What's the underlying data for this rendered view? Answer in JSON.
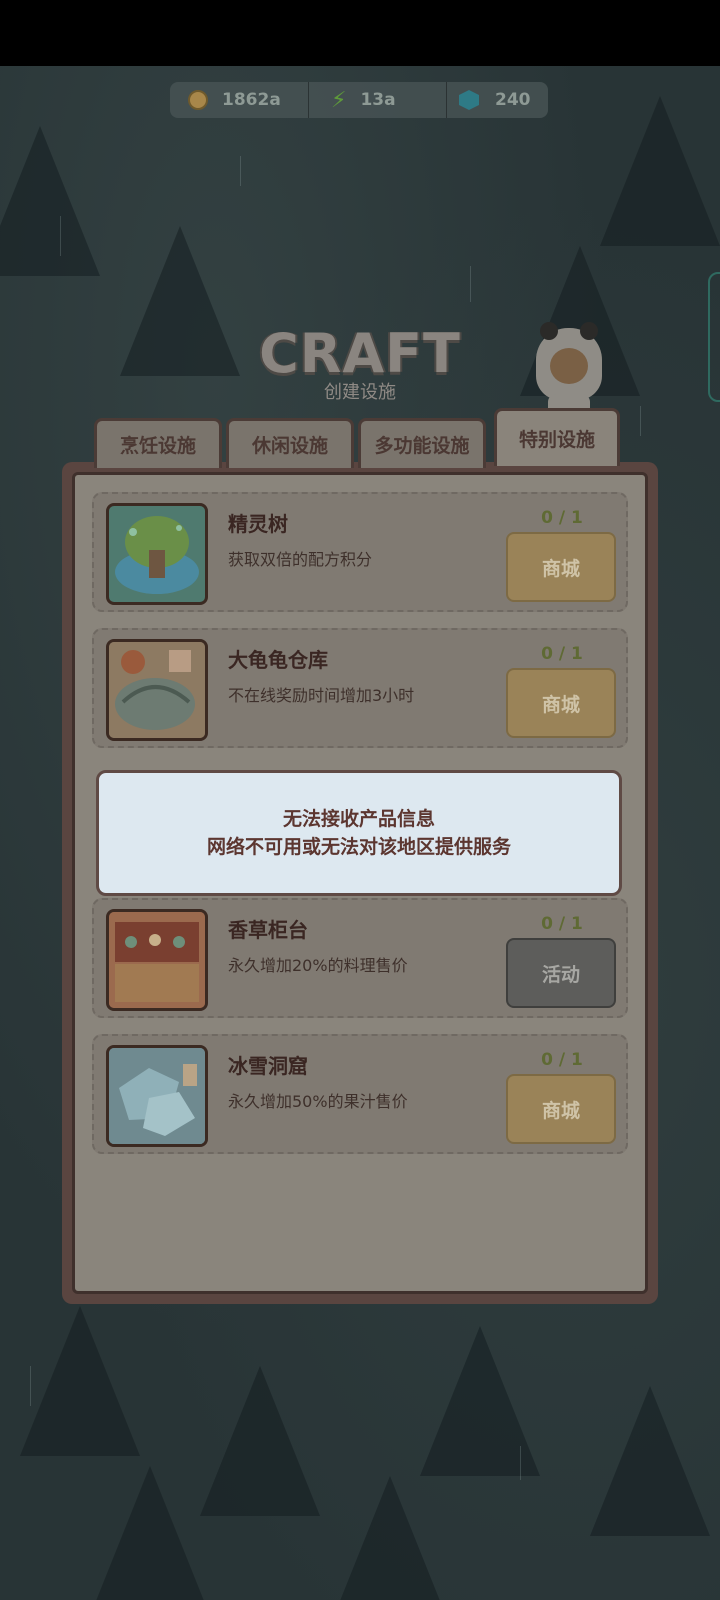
{
  "resources": {
    "coins": "1862a",
    "energy": "13a",
    "gems": "240"
  },
  "header": {
    "title": "CRAFT",
    "subtitle": "创建设施"
  },
  "tabs": [
    {
      "label": "烹饪设施",
      "active": false
    },
    {
      "label": "休闲设施",
      "active": false
    },
    {
      "label": "多功能设施",
      "active": false
    },
    {
      "label": "特别设施",
      "active": true
    }
  ],
  "items": [
    {
      "name": "精灵树",
      "desc": "获取双倍的配方积分",
      "count": "0 / 1",
      "button": "商城",
      "icon": "spirit-tree-image"
    },
    {
      "name": "大龟龟仓库",
      "desc": "不在线奖励时间增加3小时",
      "count": "0 / 1",
      "button": "商城",
      "icon": "turtle-warehouse-image"
    },
    {
      "name": "香草柜台",
      "desc": "永久增加20%的料理售价",
      "count": "0 / 1",
      "button": "活动",
      "icon": "herb-counter-image"
    },
    {
      "name": "冰雪洞窟",
      "desc": "永久增加50%的果汁售价",
      "count": "0 / 1",
      "button": "商城",
      "icon": "ice-cave-image"
    }
  ],
  "toast": {
    "line1": "无法接收产品信息",
    "line2": "网络不可用或无法对该地区提供服务"
  },
  "colors": {
    "panel": "#8a857c",
    "shop_button": "#9a8358",
    "event_button": "#5d5d5b",
    "toast_bg": "#dde8f0"
  }
}
